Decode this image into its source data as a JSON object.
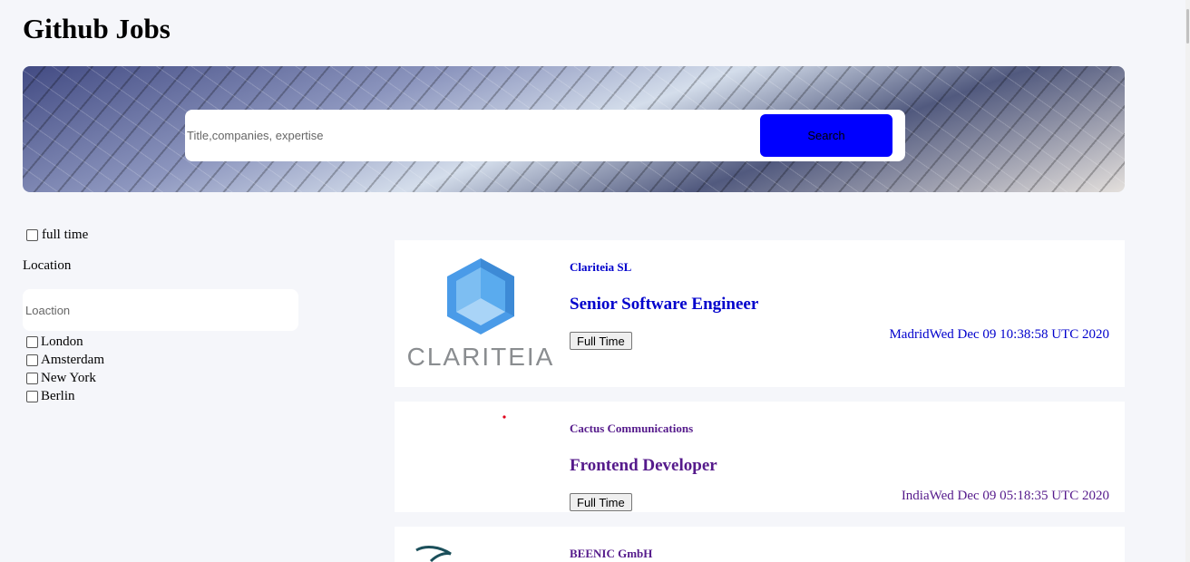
{
  "app": {
    "title": "Github Jobs"
  },
  "search": {
    "placeholder": "Title,companies, expertise",
    "value": "",
    "button_label": "Search",
    "button_color": "#0000ff"
  },
  "filters": {
    "full_time_label": "full time",
    "full_time_checked": false,
    "location_label": "Location",
    "location_placeholder": "Loaction",
    "cities": [
      {
        "label": "London",
        "checked": false
      },
      {
        "label": "Amsterdam",
        "checked": false
      },
      {
        "label": "New York",
        "checked": false
      },
      {
        "label": "Berlin",
        "checked": false
      }
    ]
  },
  "jobs": [
    {
      "company": "Clariteia SL",
      "title": "Senior Software Engineer",
      "type": "Full Time",
      "location": "Madrid",
      "date": "Wed Dec 09 10:38:58 UTC 2020",
      "logo_text": "CLARITEIA",
      "link_color": "#0000cc"
    },
    {
      "company": "Cactus Communications",
      "title": "Frontend Developer",
      "type": "Full Time",
      "location": "India",
      "date": "Wed Dec 09 05:18:35 UTC 2020",
      "link_color": "#551a8b"
    },
    {
      "company": "BEENIC GmbH",
      "link_color": "#551a8b"
    }
  ]
}
